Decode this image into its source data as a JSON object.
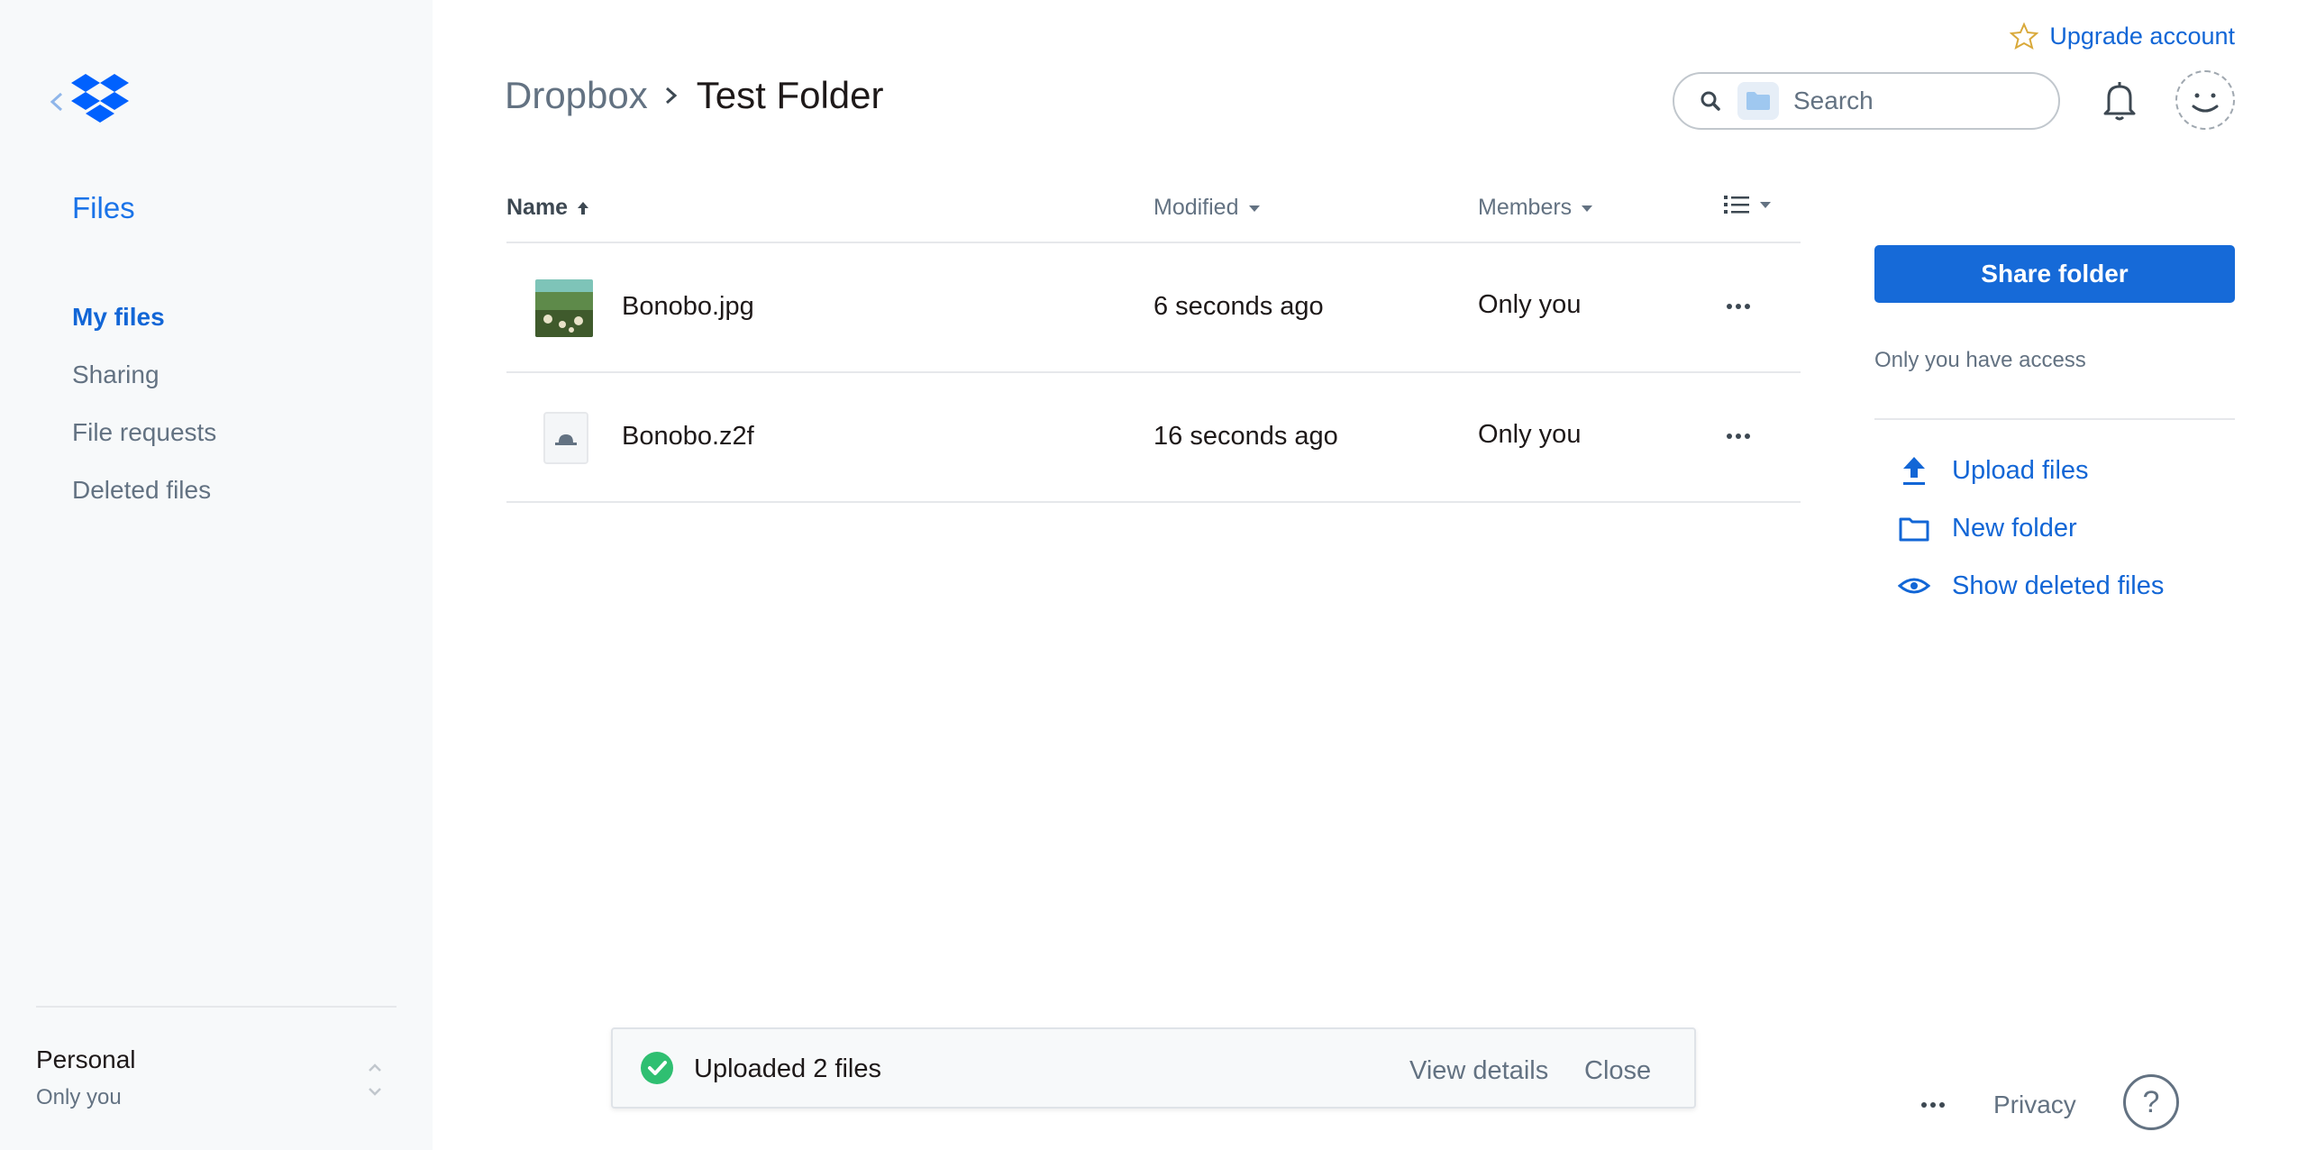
{
  "header": {
    "upgrade_label": "Upgrade account",
    "breadcrumb_root": "Dropbox",
    "breadcrumb_current": "Test Folder",
    "search_placeholder": "Search"
  },
  "sidebar": {
    "title": "Files",
    "items": [
      {
        "label": "My files",
        "active": true
      },
      {
        "label": "Sharing",
        "active": false
      },
      {
        "label": "File requests",
        "active": false
      },
      {
        "label": "Deleted files",
        "active": false
      }
    ],
    "account": {
      "name": "Personal",
      "sub": "Only you"
    }
  },
  "table": {
    "columns": {
      "name": "Name",
      "modified": "Modified",
      "members": "Members"
    },
    "rows": [
      {
        "name": "Bonobo.jpg",
        "modified": "6 seconds ago",
        "members": "Only you",
        "icon": "image-thumbnail"
      },
      {
        "name": "Bonobo.z2f",
        "modified": "16 seconds ago",
        "members": "Only you",
        "icon": "generic-file-icon"
      }
    ]
  },
  "panel": {
    "share_label": "Share folder",
    "access_text": "Only you have access",
    "actions": [
      {
        "label": "Upload files",
        "icon": "upload-icon"
      },
      {
        "label": "New folder",
        "icon": "folder-icon"
      },
      {
        "label": "Show deleted files",
        "icon": "eye-icon"
      }
    ]
  },
  "toast": {
    "message": "Uploaded 2 files",
    "view_label": "View details",
    "close_label": "Close"
  },
  "footer": {
    "privacy_label": "Privacy",
    "help_label": "?"
  },
  "colors": {
    "accent": "#1266d6",
    "muted_text": "#637282",
    "sidebar_bg": "#f7f9fa",
    "success": "#2fbf71",
    "upgrade_star": "#d9a93a"
  }
}
